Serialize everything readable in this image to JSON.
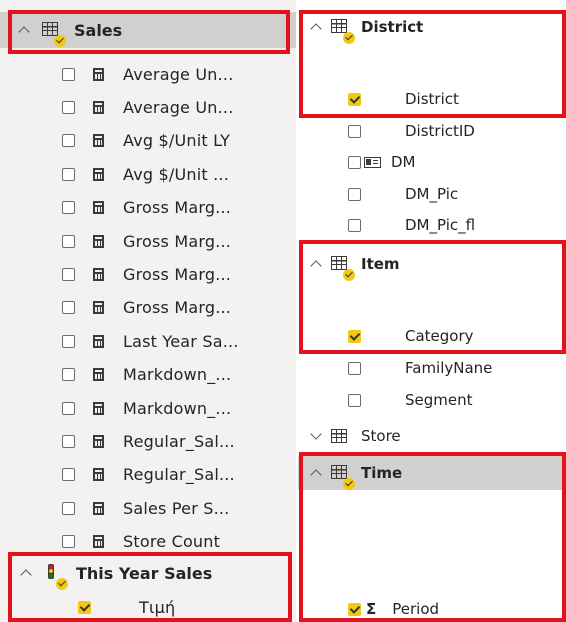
{
  "left_pane": {
    "sales_table": {
      "name": "Sales",
      "icon": "table-icon-with-check",
      "measures": [
        {
          "label": "Average Un...",
          "checked": false
        },
        {
          "label": "Average Un...",
          "checked": false
        },
        {
          "label": "Avg $/Unit LY",
          "checked": false
        },
        {
          "label": "Avg $/Unit ...",
          "checked": false
        },
        {
          "label": "Gross Marg...",
          "checked": false
        },
        {
          "label": "Gross Marg...",
          "checked": false
        },
        {
          "label": "Gross Marg...",
          "checked": false
        },
        {
          "label": "Gross Marg...",
          "checked": false
        },
        {
          "label": "Last Year Sa...",
          "checked": false
        },
        {
          "label": "Markdown_...",
          "checked": false
        },
        {
          "label": "Markdown_...",
          "checked": false
        },
        {
          "label": "Regular_Sal...",
          "checked": false
        },
        {
          "label": "Regular_Sal...",
          "checked": false
        },
        {
          "label": "Sales Per S...",
          "checked": false
        },
        {
          "label": "Store Count",
          "checked": false
        }
      ]
    },
    "kpi_group": {
      "name": "This Year Sales",
      "icon": "kpi-traffic-light-icon",
      "items": [
        {
          "label": "Τιμή",
          "checked": true
        }
      ]
    }
  },
  "right_pane": {
    "district_table": {
      "name": "District",
      "fields": [
        {
          "label": "District",
          "checked": true
        },
        {
          "label": "DistrictID",
          "checked": false
        },
        {
          "label": "DM",
          "checked": false,
          "icon": "image-field-icon"
        },
        {
          "label": "DM_Pic",
          "checked": false
        },
        {
          "label": "DM_Pic_fl",
          "checked": false
        }
      ]
    },
    "item_table": {
      "name": "Item",
      "fields": [
        {
          "label": "Category",
          "checked": true
        },
        {
          "label": "FamilyNane",
          "checked": false
        },
        {
          "label": "Segment",
          "checked": false
        }
      ]
    },
    "store_table": {
      "name": "Store",
      "expanded": false
    },
    "time_table": {
      "name": "Time",
      "fields": [
        {
          "label": "Period",
          "checked": true,
          "icon": "sigma-icon"
        }
      ]
    }
  },
  "colors": {
    "highlight": "#e3131b",
    "check": "#f2c811",
    "pane_bg": "#f3f2f1",
    "selected_header": "#d2d0ce"
  }
}
